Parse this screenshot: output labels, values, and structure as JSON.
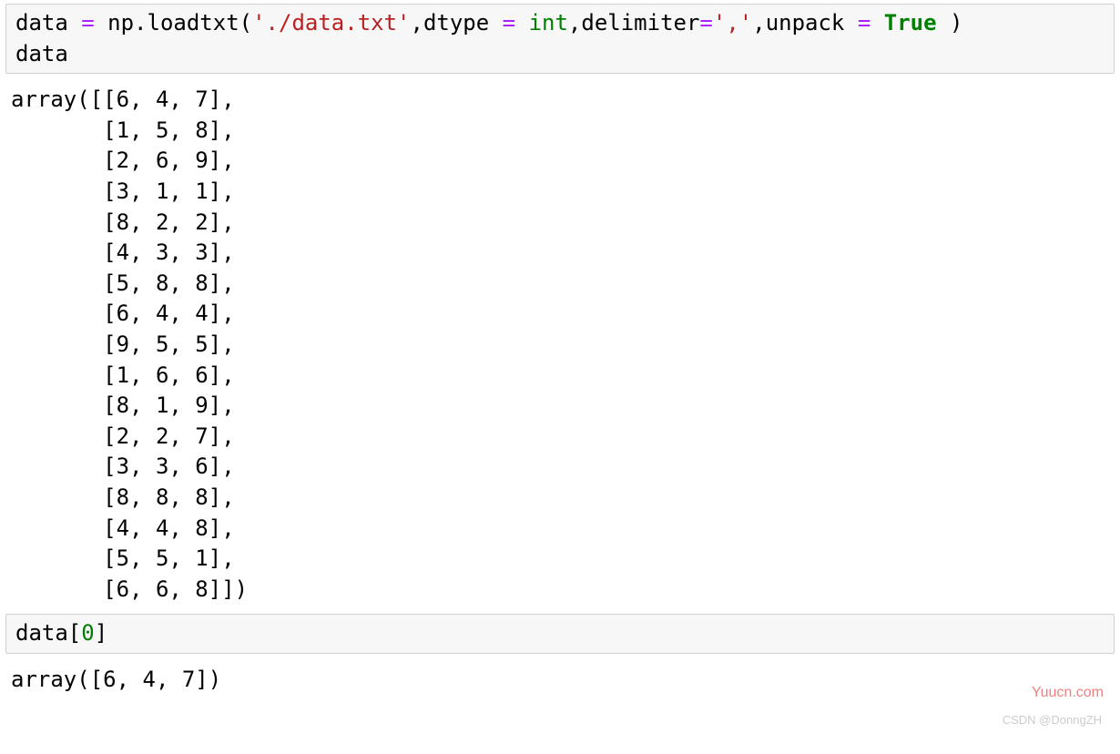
{
  "cell1": {
    "code_line1": {
      "var": "data",
      "func": "np.loadtxt",
      "arg0": "'./data.txt'",
      "kw_dtype": "dtype",
      "val_dtype": "int",
      "kw_delim": "delimiter",
      "val_delim": "','",
      "kw_unpack": "unpack",
      "val_unpack": "True"
    },
    "code_line2": "data"
  },
  "out1": {
    "prefix": "array(",
    "rows": [
      "[6, 4, 7],",
      "[1, 5, 8],",
      "[2, 6, 9],",
      "[3, 1, 1],",
      "[8, 2, 2],",
      "[4, 3, 3],",
      "[5, 8, 8],",
      "[6, 4, 4],",
      "[9, 5, 5],",
      "[1, 6, 6],",
      "[8, 1, 9],",
      "[2, 2, 7],",
      "[3, 3, 6],",
      "[8, 8, 8],",
      "[4, 4, 8],",
      "[5, 5, 1],",
      "[6, 6, 8]])"
    ]
  },
  "cell2": {
    "var": "data",
    "index": "0"
  },
  "out2": "array([6, 4, 7])",
  "watermark1": "Yuucn.com",
  "watermark2": "CSDN @DonngZH"
}
